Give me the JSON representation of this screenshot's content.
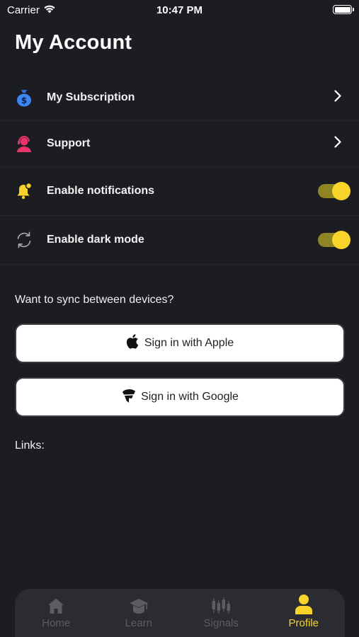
{
  "status_bar": {
    "carrier": "Carrier",
    "time": "10:47 PM"
  },
  "page_title": "My Account",
  "menu": [
    {
      "label": "My Subscription",
      "icon": "money-bag-icon",
      "control": "chevron"
    },
    {
      "label": "Support",
      "icon": "support-agent-icon",
      "control": "chevron"
    },
    {
      "label": "Enable notifications",
      "icon": "bell-icon",
      "control": "toggle",
      "on": true
    },
    {
      "label": "Enable dark mode",
      "icon": "sync-icon",
      "control": "toggle",
      "on": true
    }
  ],
  "sync_prompt": "Want to sync between devices?",
  "auth": {
    "apple_label": "Sign in with Apple",
    "google_label": "Sign in with Google"
  },
  "links_label": "Links:",
  "tabs": [
    {
      "label": "Home",
      "icon": "home-icon",
      "active": false
    },
    {
      "label": "Learn",
      "icon": "graduation-cap-icon",
      "active": false
    },
    {
      "label": "Signals",
      "icon": "candlestick-icon",
      "active": false
    },
    {
      "label": "Profile",
      "icon": "person-icon",
      "active": true
    }
  ],
  "colors": {
    "background": "#1c1d22",
    "accent": "#f8d32a",
    "tab_bar": "#2b2c32",
    "inactive_tab": "#5c5d63"
  }
}
